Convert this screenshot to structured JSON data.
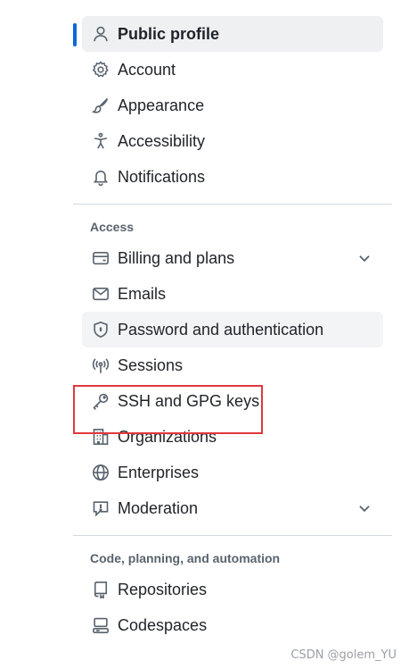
{
  "nav": {
    "top_items": [
      {
        "label": "Public profile",
        "icon": "person-icon",
        "selected": true
      },
      {
        "label": "Account",
        "icon": "gear-icon"
      },
      {
        "label": "Appearance",
        "icon": "paintbrush-icon"
      },
      {
        "label": "Accessibility",
        "icon": "accessibility-icon"
      },
      {
        "label": "Notifications",
        "icon": "bell-icon"
      }
    ],
    "access_heading": "Access",
    "access_items": [
      {
        "label": "Billing and plans",
        "icon": "credit-card-icon",
        "expandable": true
      },
      {
        "label": "Emails",
        "icon": "mail-icon"
      },
      {
        "label": "Password and authentication",
        "icon": "shield-lock-icon",
        "hovered": true
      },
      {
        "label": "Sessions",
        "icon": "broadcast-icon"
      },
      {
        "label": "SSH and GPG keys",
        "icon": "key-icon",
        "highlighted": true
      },
      {
        "label": "Organizations",
        "icon": "organization-icon"
      },
      {
        "label": "Enterprises",
        "icon": "globe-icon"
      },
      {
        "label": "Moderation",
        "icon": "report-icon",
        "expandable": true
      }
    ],
    "code_heading": "Code, planning, and automation",
    "code_items": [
      {
        "label": "Repositories",
        "icon": "repo-icon"
      },
      {
        "label": "Codespaces",
        "icon": "codespaces-icon"
      }
    ]
  },
  "colors": {
    "accent": "#0969da",
    "highlight_border": "#e0393e",
    "icon": "#59636e",
    "selected_bg": "#eef0f2"
  },
  "watermark": "CSDN @golem_YU"
}
